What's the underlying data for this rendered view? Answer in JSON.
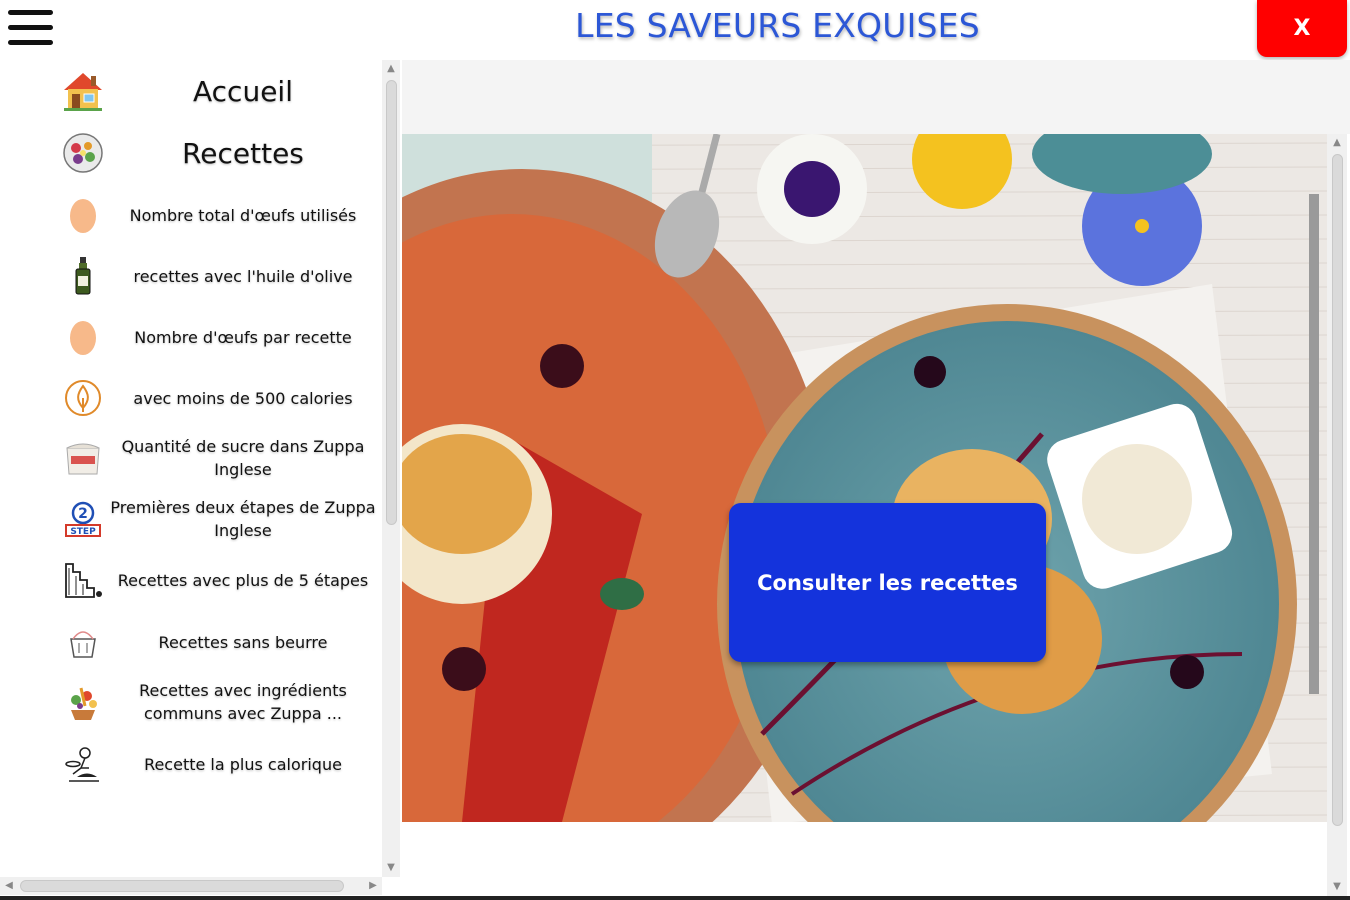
{
  "header": {
    "title": "LES SAVEURS EXQUISES",
    "close_label": "X"
  },
  "sidebar": {
    "items": [
      {
        "label": "Accueil",
        "icon": "house-icon"
      },
      {
        "label": "Recettes",
        "icon": "salad-bowl-icon"
      },
      {
        "label": "Nombre total d'œufs utilisés",
        "icon": "egg-icon"
      },
      {
        "label": "recettes avec l'huile d'olive",
        "icon": "olive-oil-bottle-icon"
      },
      {
        "label": "Nombre d'œufs par recette",
        "icon": "egg-icon"
      },
      {
        "label": "avec moins de 500 calories",
        "icon": "calorie-flame-icon"
      },
      {
        "label": "Quantité de sucre dans Zuppa Inglese",
        "icon": "sugar-bag-icon"
      },
      {
        "label": "Premières deux étapes de Zuppa Inglese",
        "icon": "two-step-icon"
      },
      {
        "label": "Recettes avec plus de 5 étapes",
        "icon": "stairs-icon"
      },
      {
        "label": "Recettes sans beurre",
        "icon": "no-butter-icon"
      },
      {
        "label": "Recettes avec ingrédients communs avec Zuppa ...",
        "icon": "ingredients-icon"
      },
      {
        "label": "Recette la plus calorique",
        "icon": "chef-icon"
      }
    ]
  },
  "main": {
    "cta_label": "Consulter les recettes"
  },
  "colors": {
    "title": "#2c57d6",
    "close": "#ff0000",
    "cta": "#1433dc"
  }
}
